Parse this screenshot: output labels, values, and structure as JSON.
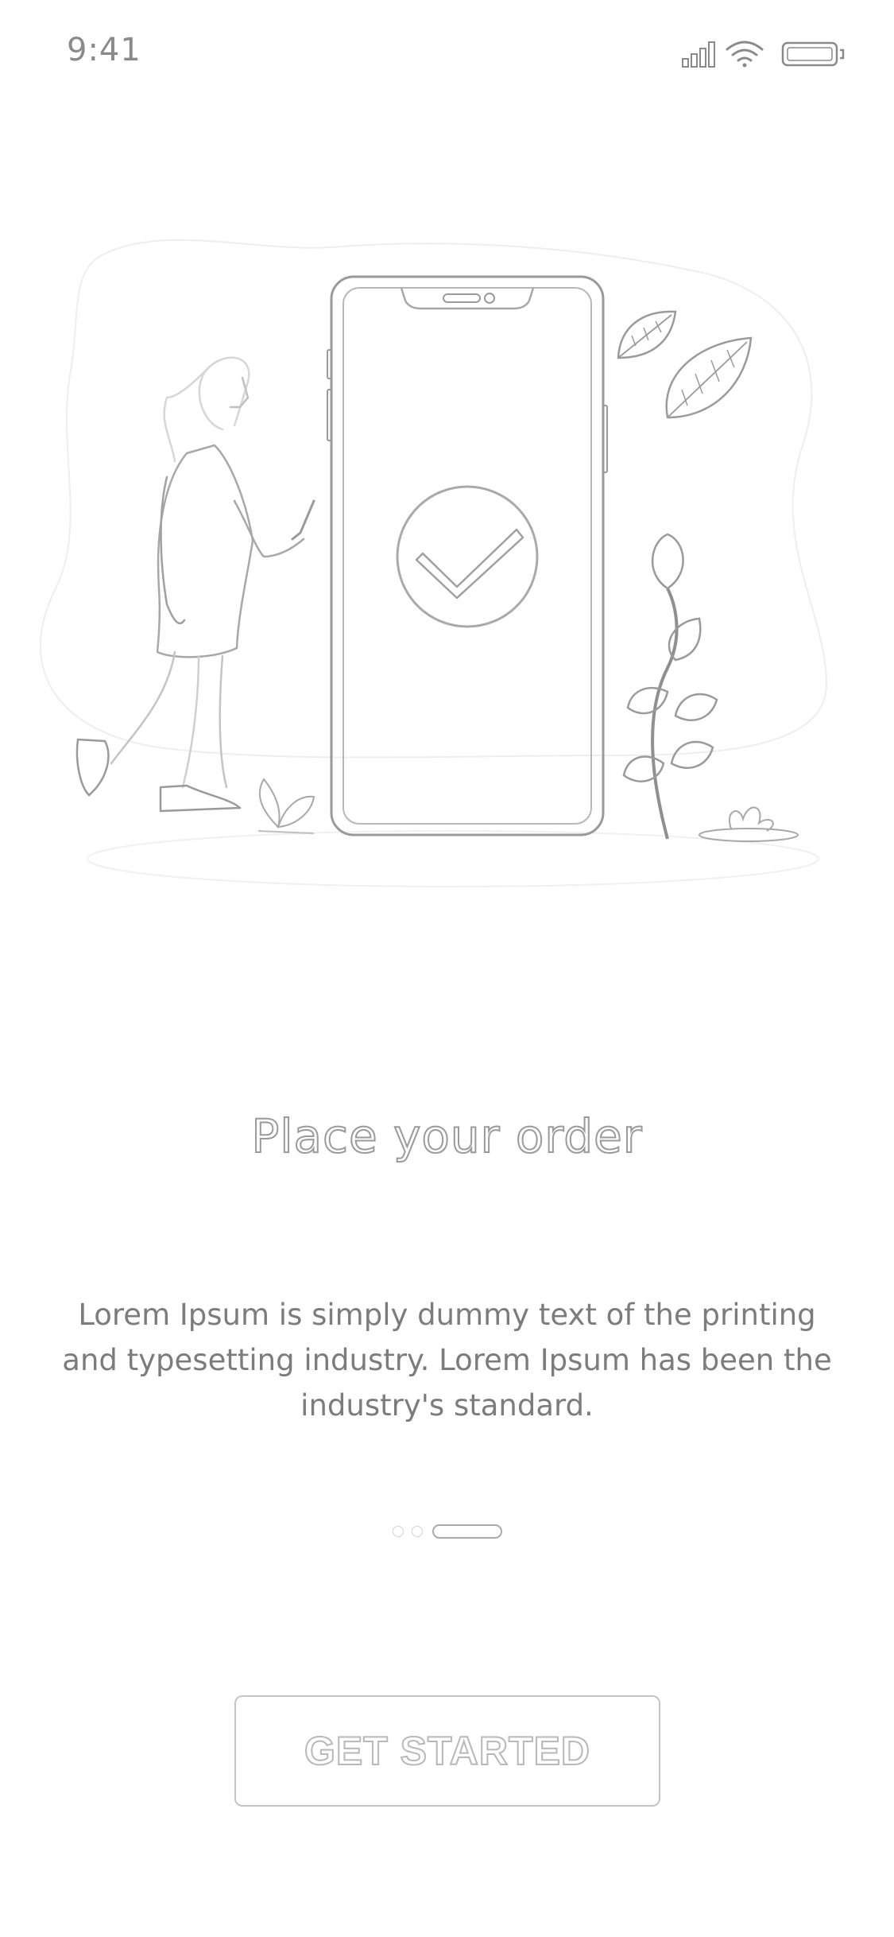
{
  "status_bar": {
    "time": "9:41",
    "icons": [
      "cellular-signal-icon",
      "wifi-icon",
      "battery-icon"
    ]
  },
  "illustration": {
    "icon": "order-confirmed-illustration",
    "colors": {
      "stroke": "#9a9a9a",
      "light": "#e6e6e6"
    }
  },
  "onboarding": {
    "title": "Place your order",
    "description": "Lorem Ipsum is simply dummy text of the printing and typesetting industry. Lorem Ipsum has been the industry's standard.",
    "pager": {
      "total": 3,
      "active": 3
    },
    "cta_label": "GET STARTED"
  }
}
